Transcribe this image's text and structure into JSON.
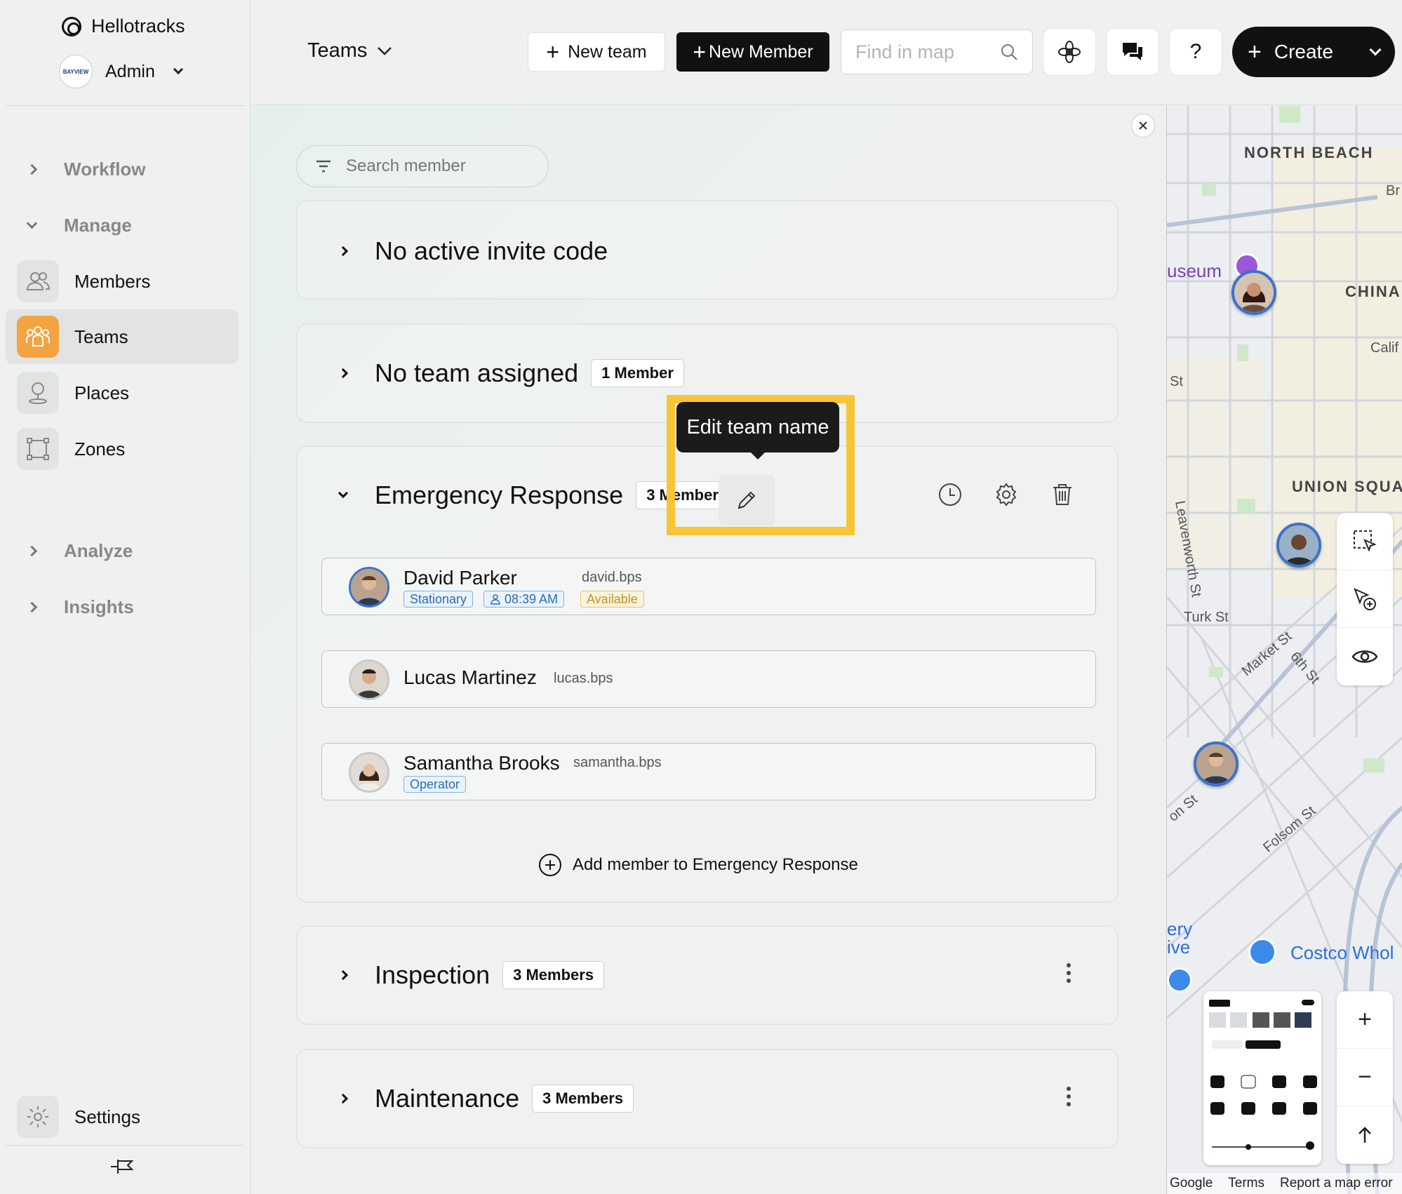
{
  "sidebar": {
    "brand": "Hellotracks",
    "org_logo_text": "BAYVIEW",
    "user": "Admin",
    "groups": {
      "workflow": "Workflow",
      "manage": "Manage",
      "analyze": "Analyze",
      "insights": "Insights"
    },
    "items": [
      {
        "label": "Members",
        "icon": "members-icon"
      },
      {
        "label": "Teams",
        "icon": "teams-icon"
      },
      {
        "label": "Places",
        "icon": "place-pin-icon"
      },
      {
        "label": "Zones",
        "icon": "zone-icon"
      }
    ],
    "settings": "Settings",
    "accent_color": "#f4a340"
  },
  "topbar": {
    "teams_dropdown": "Teams",
    "new_team": "New team",
    "new_member": "New Member",
    "find_placeholder": "Find in map",
    "help": "?",
    "create": "Create"
  },
  "main": {
    "search_placeholder": "Search member",
    "sections": [
      {
        "title": "No active invite code"
      },
      {
        "title": "No team assigned",
        "badge": "1 Member"
      },
      {
        "title": "Emergency Response",
        "badge": "3 Members",
        "tooltip": "Edit team name",
        "members": [
          {
            "name": "David Parker",
            "username": "david.bps",
            "tags": [
              "Stationary",
              "08:39 AM",
              "Available"
            ]
          },
          {
            "name": "Lucas Martinez",
            "username": "lucas.bps",
            "tags": []
          },
          {
            "name": "Samantha Brooks",
            "username": "samantha.bps",
            "tags": [
              "Operator"
            ]
          }
        ],
        "add_member": "Add member to Emergency Response"
      },
      {
        "title": "Inspection",
        "badge": "3 Members"
      },
      {
        "title": "Maintenance",
        "badge": "3 Members"
      }
    ],
    "highlight_color": "#f7c535"
  },
  "map": {
    "labels": {
      "north_beach": "NORTH BEACH",
      "china": "CHINA",
      "union_square": "UNION SQUA",
      "museum": "useum",
      "costco": "Costco Whol"
    },
    "streets": [
      "St",
      "Calif",
      "Br",
      "Leavenworth St",
      "Turk St",
      "Market St",
      "6th St",
      "Folsom St",
      "on St"
    ],
    "other_text": [
      "ery",
      "ive"
    ],
    "footer": [
      "Google",
      "Terms",
      "Report a map error"
    ],
    "zoom_in": "+",
    "zoom_out": "−"
  }
}
